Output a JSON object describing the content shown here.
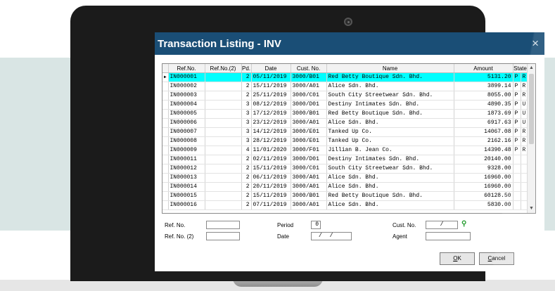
{
  "window": {
    "title": "Transaction Listing - INV",
    "close_glyph": "×"
  },
  "table": {
    "columns": [
      "Ref.No.",
      "Ref.No.(2)",
      "Pd.",
      "Date",
      "Cust. No.",
      "Name",
      "Amount",
      "State"
    ],
    "rows": [
      {
        "ref": "IN000001",
        "ref2": "",
        "pd": "2",
        "date": "05/11/2019",
        "cust": "3000/B01",
        "name": "Red Betty Boutique Sdn. Bhd.",
        "amount": "5131.20",
        "s1": "P",
        "s2": "R",
        "selected": true
      },
      {
        "ref": "IN000002",
        "ref2": "",
        "pd": "2",
        "date": "15/11/2019",
        "cust": "3000/A01",
        "name": "Alice Sdn. Bhd.",
        "amount": "3899.14",
        "s1": "P",
        "s2": "R"
      },
      {
        "ref": "IN000003",
        "ref2": "",
        "pd": "2",
        "date": "25/11/2019",
        "cust": "3000/C01",
        "name": "South City Streetwear Sdn. Bhd.",
        "amount": "8055.00",
        "s1": "P",
        "s2": "R"
      },
      {
        "ref": "IN000004",
        "ref2": "",
        "pd": "3",
        "date": "08/12/2019",
        "cust": "3000/D01",
        "name": "Destiny Intimates Sdn. Bhd.",
        "amount": "4890.35",
        "s1": "P",
        "s2": "U"
      },
      {
        "ref": "IN000005",
        "ref2": "",
        "pd": "3",
        "date": "17/12/2019",
        "cust": "3000/B01",
        "name": "Red Betty Boutique Sdn. Bhd.",
        "amount": "1873.69",
        "s1": "P",
        "s2": "U"
      },
      {
        "ref": "IN000006",
        "ref2": "",
        "pd": "3",
        "date": "23/12/2019",
        "cust": "3000/A01",
        "name": "Alice Sdn. Bhd.",
        "amount": "6917.63",
        "s1": "P",
        "s2": "U"
      },
      {
        "ref": "IN000007",
        "ref2": "",
        "pd": "3",
        "date": "14/12/2019",
        "cust": "3000/E01",
        "name": "Tanked Up Co.",
        "amount": "14067.08",
        "s1": "P",
        "s2": "R"
      },
      {
        "ref": "IN000008",
        "ref2": "",
        "pd": "3",
        "date": "28/12/2019",
        "cust": "3000/E01",
        "name": "Tanked Up Co.",
        "amount": "2162.16",
        "s1": "P",
        "s2": "R"
      },
      {
        "ref": "IN000009",
        "ref2": "",
        "pd": "4",
        "date": "11/01/2020",
        "cust": "3000/F01",
        "name": "Jillian B. Jean Co.",
        "amount": "14390.48",
        "s1": "P",
        "s2": "R"
      },
      {
        "ref": "IN000011",
        "ref2": "",
        "pd": "2",
        "date": "02/11/2019",
        "cust": "3000/D01",
        "name": "Destiny Intimates Sdn. Bhd.",
        "amount": "20140.00",
        "s1": "",
        "s2": ""
      },
      {
        "ref": "IN000012",
        "ref2": "",
        "pd": "2",
        "date": "15/11/2019",
        "cust": "3000/C01",
        "name": "South City Streetwear Sdn. Bhd.",
        "amount": "9328.00",
        "s1": "",
        "s2": ""
      },
      {
        "ref": "IN000013",
        "ref2": "",
        "pd": "2",
        "date": "06/11/2019",
        "cust": "3000/A01",
        "name": "Alice Sdn. Bhd.",
        "amount": "16960.00",
        "s1": "",
        "s2": ""
      },
      {
        "ref": "IN000014",
        "ref2": "",
        "pd": "2",
        "date": "20/11/2019",
        "cust": "3000/A01",
        "name": "Alice Sdn. Bhd.",
        "amount": "16960.00",
        "s1": "",
        "s2": ""
      },
      {
        "ref": "IN000015",
        "ref2": "",
        "pd": "2",
        "date": "15/11/2019",
        "cust": "3000/B01",
        "name": "Red Betty Boutique Sdn. Bhd.",
        "amount": "60128.50",
        "s1": "",
        "s2": ""
      },
      {
        "ref": "IN000016",
        "ref2": "",
        "pd": "2",
        "date": "07/11/2019",
        "cust": "3000/A01",
        "name": "Alice Sdn. Bhd.",
        "amount": "5830.00",
        "s1": "",
        "s2": ""
      }
    ],
    "row_indicator": "▶",
    "scroll_up": "▲",
    "scroll_down": "▼"
  },
  "filters": {
    "ref_no_label": "Ref. No.",
    "ref_no2_label": "Ref. No. (2)",
    "period_label": "Period",
    "period_value": "0",
    "date_label": "Date",
    "date_value": "/ /",
    "cust_no_label": "Cust. No.",
    "cust_no_value": "/",
    "agent_label": "Agent",
    "search_icon": "search-icon"
  },
  "buttons": {
    "ok_underline": "O",
    "ok_rest": "K",
    "cancel_underline": "C",
    "cancel_rest": "ancel"
  },
  "colors": {
    "titlebar": "#1a4e76",
    "selected_row": "#00ffff",
    "backdrop_band": "#d9e5e4"
  }
}
